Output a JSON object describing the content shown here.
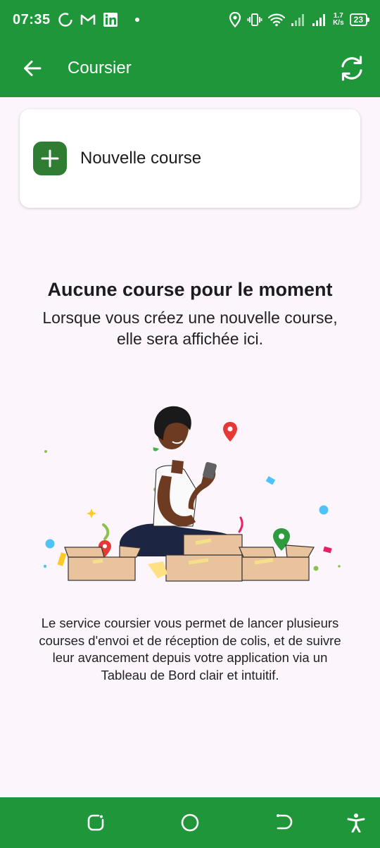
{
  "status_bar": {
    "time": "07:35",
    "net_speed_value": "1.7",
    "net_speed_unit": "K/s",
    "battery": "23"
  },
  "app_bar": {
    "title": "Coursier",
    "back_icon": "arrow-left-icon",
    "refresh_icon": "refresh-icon"
  },
  "new_course": {
    "label": "Nouvelle course",
    "icon": "plus-icon"
  },
  "empty_state": {
    "title": "Aucune course pour le moment",
    "subtitle": "Lorsque vous créez une nouvelle course, elle sera affichée ici.",
    "description": "Le service coursier vous permet de lancer plusieurs courses d'envoi et de réception de colis, et de suivre leur avancement depuis votre application via un Tableau de Bord clair et intuitif."
  },
  "colors": {
    "brand_green": "#1e9639",
    "button_green": "#2e7d32",
    "background": "#fcf6fc"
  },
  "nav_bar": {
    "icons": [
      "recents-icon",
      "home-icon",
      "back-icon",
      "accessibility-icon"
    ]
  }
}
